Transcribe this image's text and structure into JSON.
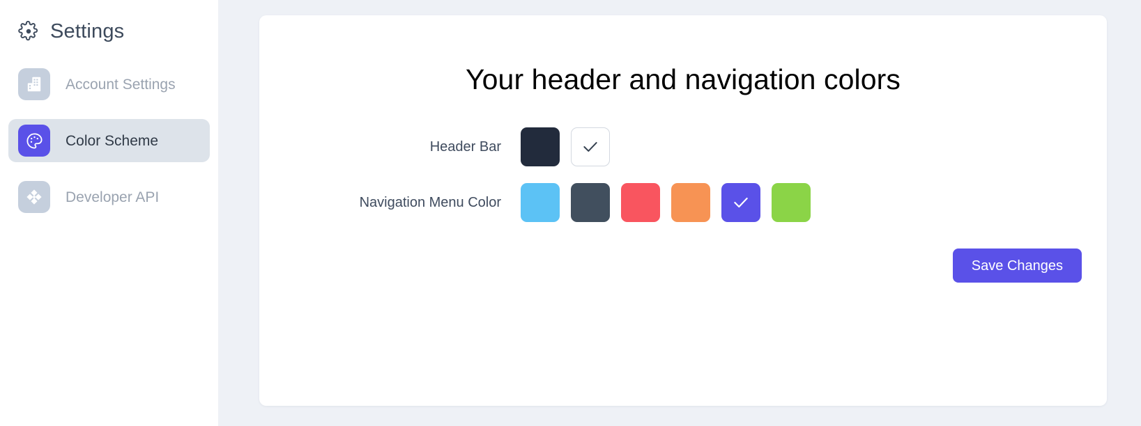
{
  "sidebar": {
    "header": {
      "icon": "gear-icon",
      "title": "Settings"
    },
    "items": [
      {
        "label": "Account Settings",
        "icon": "building-icon",
        "active": false
      },
      {
        "label": "Color Scheme",
        "icon": "palette-icon",
        "active": true
      },
      {
        "label": "Developer API",
        "icon": "diamond-nodes-icon",
        "active": false
      }
    ]
  },
  "card": {
    "title": "Your header and navigation colors",
    "rows": [
      {
        "label": "Header Bar",
        "swatches": [
          {
            "color": "#222b3c",
            "selected": false,
            "bordered": false
          },
          {
            "color": "#ffffff",
            "selected": true,
            "bordered": true,
            "check_color": "#34404f"
          }
        ]
      },
      {
        "label": "Navigation Menu Color",
        "swatches": [
          {
            "color": "#5cc2f5",
            "selected": false,
            "bordered": false
          },
          {
            "color": "#414f5e",
            "selected": false,
            "bordered": false
          },
          {
            "color": "#f9555f",
            "selected": false,
            "bordered": false
          },
          {
            "color": "#f79354",
            "selected": false,
            "bordered": false
          },
          {
            "color": "#5a51e8",
            "selected": true,
            "bordered": false,
            "check_color": "#ffffff"
          },
          {
            "color": "#8bd447",
            "selected": false,
            "bordered": false
          }
        ]
      }
    ],
    "save_label": "Save Changes"
  },
  "colors": {
    "page_background": "#eef1f6",
    "sidebar_background": "#ffffff",
    "accent": "#5a51e8",
    "active_item_background": "#dde3ea",
    "inactive_icon_background": "#c5cfdd",
    "inactive_label": "#9aa3b0"
  }
}
